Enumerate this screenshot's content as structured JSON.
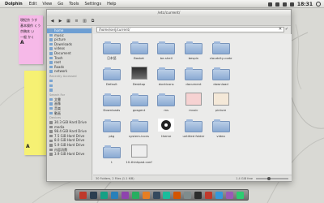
{
  "topbar": {
    "app_name": "Dolphin",
    "menus": [
      "Edit",
      "View",
      "Go",
      "Tools",
      "Settings",
      "Help"
    ],
    "clock": "18:31"
  },
  "notes": {
    "pink": [
      "現紀京 うす",
      "基本操作 くう",
      "京稿本 い",
      "一般 かく",
      "A"
    ],
    "yellow": [
      "",
      "",
      "",
      "",
      "",
      "",
      "",
      "",
      "A"
    ]
  },
  "window": {
    "title": "/etc/current/",
    "location": "/home/serj/current/"
  },
  "sidebar": {
    "places": [
      "home",
      "music",
      "picture",
      "Downloads",
      "videos",
      "Document",
      "Trash",
      "root",
      "Roads",
      "network"
    ],
    "recent_head": "Recently Accessed",
    "recent": [
      "",
      "",
      "",
      "",
      "",
      "",
      ""
    ],
    "search_head": "Search For",
    "search": [
      "文書",
      "画像",
      "音楽",
      "動画"
    ],
    "devices_head": "Devices",
    "devices": [
      "30.3 GiB Hard Drive",
      "media",
      "98.4 GiB Hard Drive",
      "7.5 GiB Hard Drive",
      "8.0 GiB Hard Drive",
      "5.9 GiB Hard Drive",
      "内容消費",
      "3.9 GiB Hard Drive"
    ]
  },
  "items": [
    {
      "label": "日本語",
      "kind": "folder"
    },
    {
      "label": "Basket",
      "kind": "folder"
    },
    {
      "label": "be-shell",
      "kind": "folder"
    },
    {
      "label": "bespin",
      "kind": "folder"
    },
    {
      "label": "cloudcity-code",
      "kind": "folder"
    },
    {
      "label": "",
      "kind": "none"
    },
    {
      "label": "",
      "kind": "none"
    },
    {
      "label": "Default",
      "kind": "folder"
    },
    {
      "label": "Desktop",
      "kind": "desktop"
    },
    {
      "label": "dockicons",
      "kind": "folder"
    },
    {
      "label": "document",
      "kind": "folder"
    },
    {
      "label": "download",
      "kind": "folder"
    },
    {
      "label": "",
      "kind": "none"
    },
    {
      "label": "",
      "kind": "none"
    },
    {
      "label": "Downloads",
      "kind": "downloads"
    },
    {
      "label": "gosgent",
      "kind": "folder"
    },
    {
      "label": "ms",
      "kind": "folder"
    },
    {
      "label": "music",
      "kind": "music"
    },
    {
      "label": "picture",
      "kind": "picture"
    },
    {
      "label": "",
      "kind": "none"
    },
    {
      "label": "",
      "kind": "none"
    },
    {
      "label": "pkg",
      "kind": "folder"
    },
    {
      "label": "system-icons",
      "kind": "folder"
    },
    {
      "label": "theme",
      "kind": "theme"
    },
    {
      "label": "untitled folder",
      "kind": "folder"
    },
    {
      "label": "video",
      "kind": "folder"
    },
    {
      "label": "",
      "kind": "none"
    },
    {
      "label": "",
      "kind": "none"
    },
    {
      "label": "t",
      "kind": "folder"
    },
    {
      "label": "10-thinkpad.conf",
      "kind": "file"
    }
  ],
  "status": {
    "summary": "30 Folders, 2 Files (1.1 KiB)",
    "free": "1.4 GiB free"
  },
  "colors": {
    "accent": "#6e9fd3",
    "folder": "#9fb8da"
  },
  "dock": [
    "#c0392b",
    "#2c3e50",
    "#16a085",
    "#2980b9",
    "#8e44ad",
    "#27ae60",
    "#e67e22",
    "#34495e",
    "#1abc9c",
    "#d35400",
    "#7f8c8d",
    "#2c2c2c",
    "#c0392b",
    "#3498db",
    "#9b59b6",
    "#2ecc71"
  ]
}
